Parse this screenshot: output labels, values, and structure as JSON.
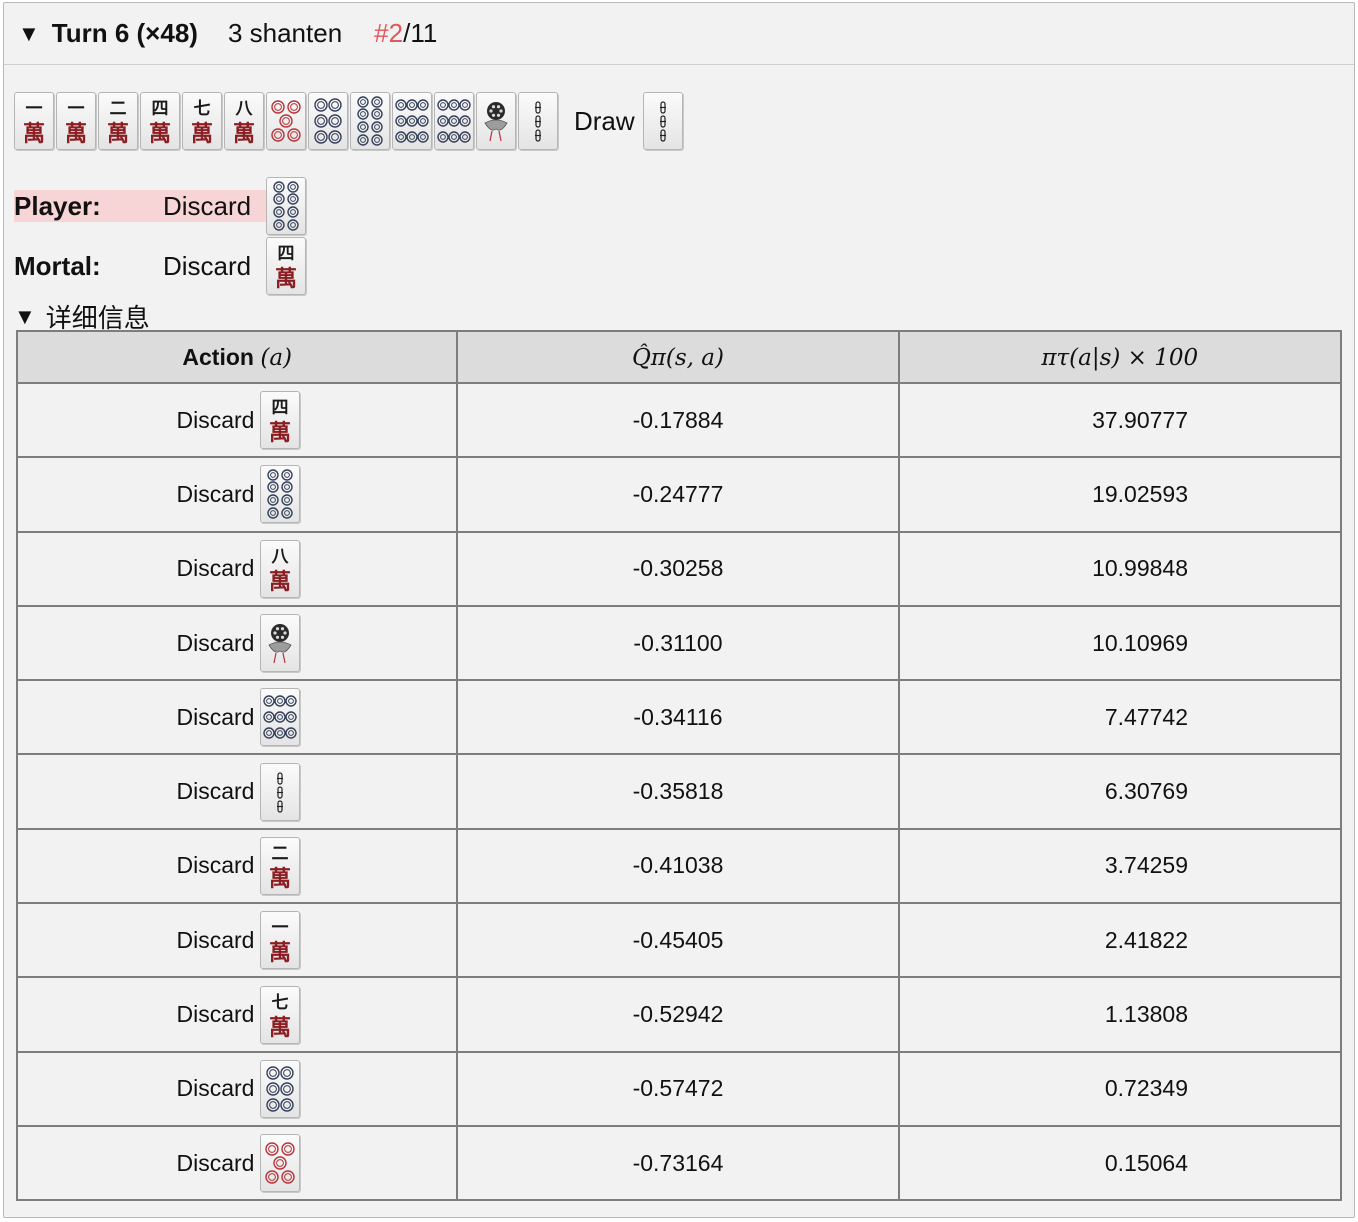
{
  "summary": {
    "turn": "Turn 6 (×48)",
    "shanten": "3 shanten",
    "rank_prefix": "#2",
    "rank_total": "/11"
  },
  "hand": [
    "1m",
    "1m",
    "2m",
    "4m",
    "7m",
    "8m",
    "5p",
    "6p",
    "8p",
    "9p",
    "9p",
    "1s",
    "3s"
  ],
  "draw": {
    "label": "Draw",
    "tile": "3s"
  },
  "player": {
    "label": "Player:",
    "action": "Discard",
    "tile": "8p"
  },
  "mortal": {
    "label": "Mortal:",
    "action": "Discard",
    "tile": "4m"
  },
  "details_label": "详细信息",
  "table": {
    "headers": {
      "action": "Action",
      "action_var": "(a)",
      "q": "Q̂π(s, a)",
      "pi": "πτ(a|s) × 100"
    },
    "rows": [
      {
        "action": "Discard",
        "tile": "4m",
        "q": "-0.17884",
        "pi": "37.90777"
      },
      {
        "action": "Discard",
        "tile": "8p",
        "q": "-0.24777",
        "pi": "19.02593"
      },
      {
        "action": "Discard",
        "tile": "8m",
        "q": "-0.30258",
        "pi": "10.99848"
      },
      {
        "action": "Discard",
        "tile": "1s",
        "q": "-0.31100",
        "pi": "10.10969"
      },
      {
        "action": "Discard",
        "tile": "9p",
        "q": "-0.34116",
        "pi": "7.47742"
      },
      {
        "action": "Discard",
        "tile": "3s",
        "q": "-0.35818",
        "pi": "6.30769"
      },
      {
        "action": "Discard",
        "tile": "2m",
        "q": "-0.41038",
        "pi": "3.74259"
      },
      {
        "action": "Discard",
        "tile": "1m",
        "q": "-0.45405",
        "pi": "2.41822"
      },
      {
        "action": "Discard",
        "tile": "7m",
        "q": "-0.52942",
        "pi": "1.13808"
      },
      {
        "action": "Discard",
        "tile": "6p",
        "q": "-0.57472",
        "pi": "0.72349"
      },
      {
        "action": "Discard",
        "tile": "5p",
        "q": "-0.73164",
        "pi": "0.15064"
      }
    ]
  },
  "colors": {
    "rank": "#e0575b",
    "highlight": "#f7d5d6",
    "panel": "#f2f2f2",
    "header": "#dcdcdc"
  }
}
